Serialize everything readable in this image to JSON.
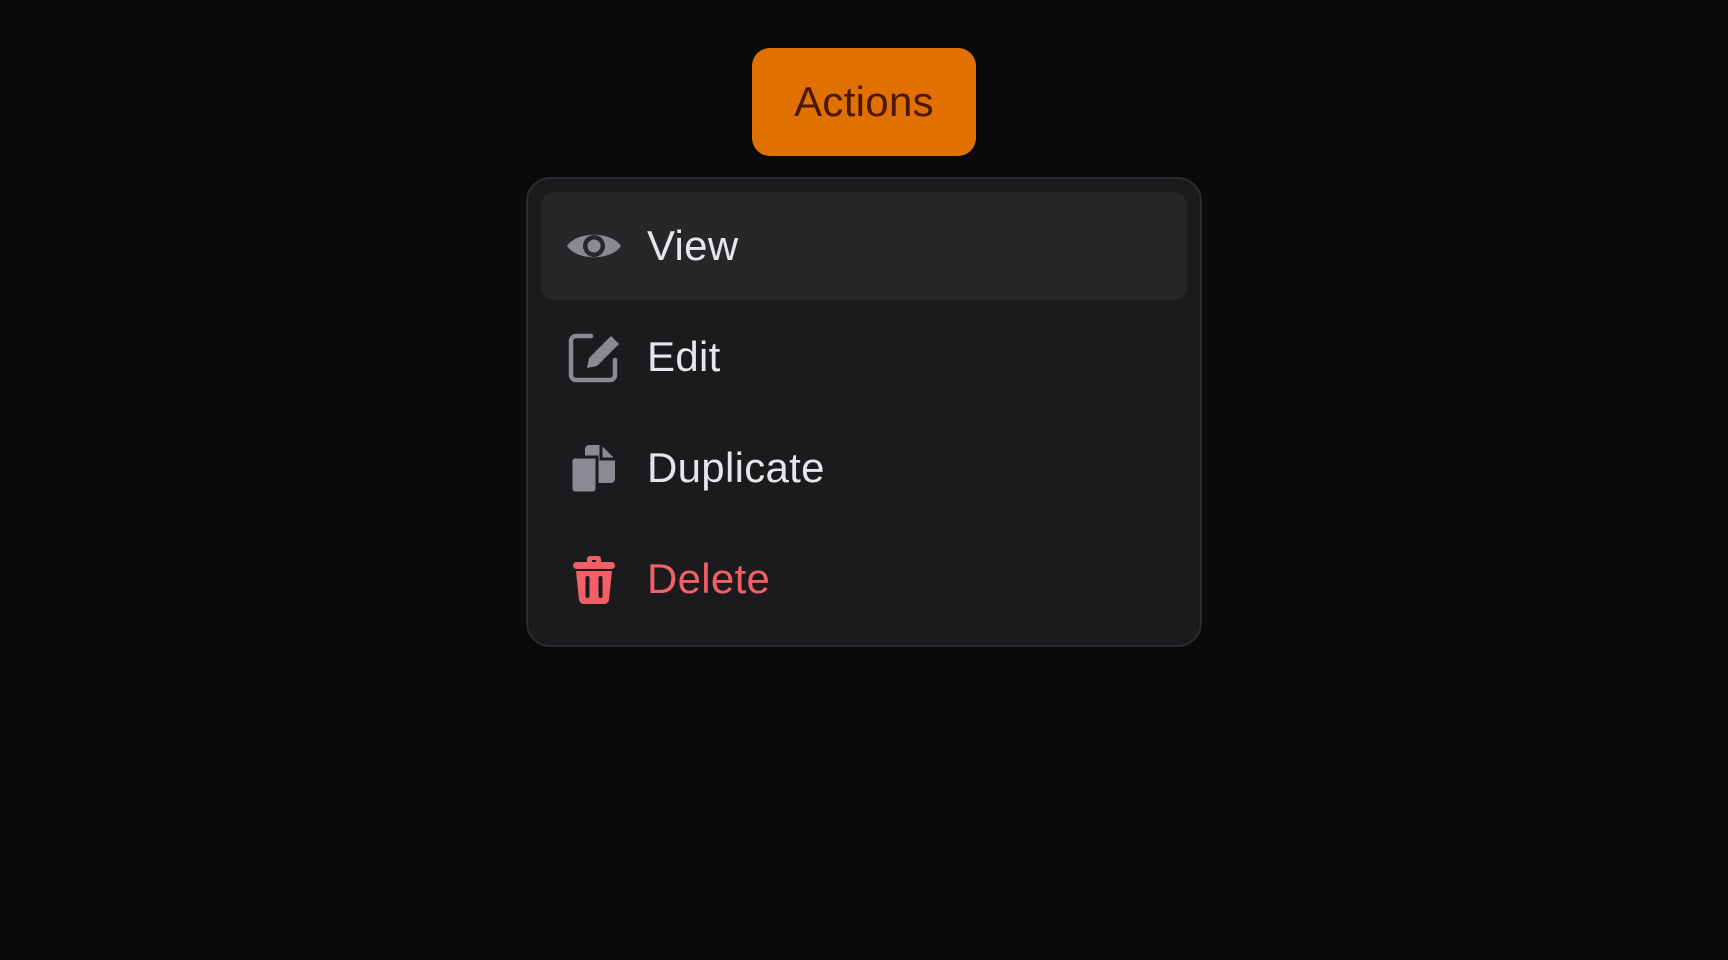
{
  "trigger": {
    "label": "Actions"
  },
  "menu": {
    "items": [
      {
        "label": "View",
        "icon": "eye-icon",
        "active": true
      },
      {
        "label": "Edit",
        "icon": "edit-icon",
        "active": false
      },
      {
        "label": "Duplicate",
        "icon": "duplicate-icon",
        "active": false
      },
      {
        "label": "Delete",
        "icon": "trash-icon",
        "active": false,
        "danger": true
      }
    ]
  },
  "colors": {
    "accent": "#e07000",
    "accent_text": "#4a1804",
    "icon": "#8a8a93",
    "danger": "#f25f66",
    "menu_bg": "#1b1b1e",
    "active_bg": "#27272a"
  }
}
